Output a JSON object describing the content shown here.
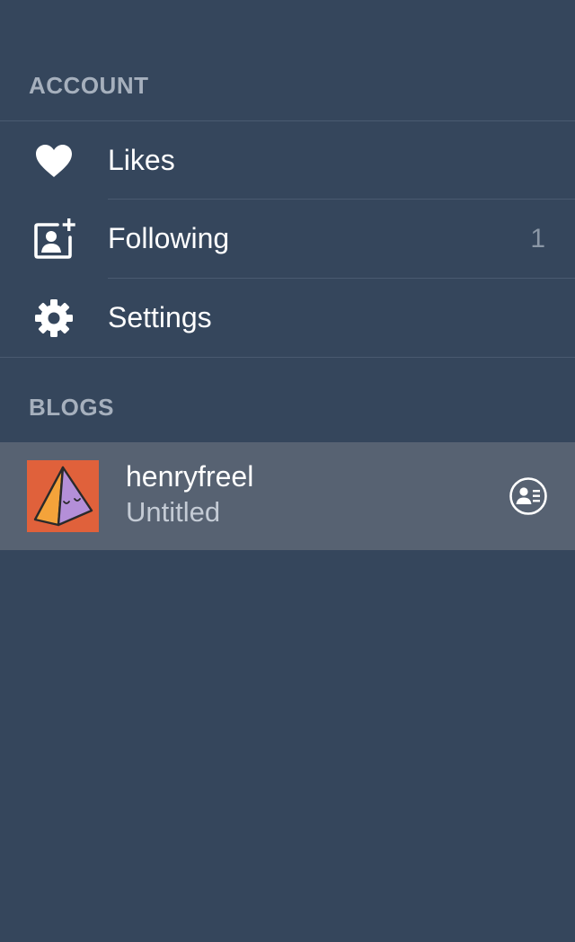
{
  "account_section": {
    "header": "ACCOUNT",
    "items": [
      {
        "label": "Likes",
        "icon": "heart-icon",
        "count": ""
      },
      {
        "label": "Following",
        "icon": "add-contact-icon",
        "count": "1"
      },
      {
        "label": "Settings",
        "icon": "gear-icon",
        "count": ""
      }
    ]
  },
  "blogs_section": {
    "header": "BLOGS",
    "blogs": [
      {
        "name": "henryfreel",
        "title": "Untitled",
        "avatar_icon": "pyramid-avatar",
        "action_icon": "blog-settings-icon"
      }
    ]
  },
  "colors": {
    "background": "#35465c",
    "selected_row": "#576272",
    "avatar_bg": "#e0613b",
    "header_text": "#a6b0bd",
    "muted_text": "#8b97a6"
  }
}
